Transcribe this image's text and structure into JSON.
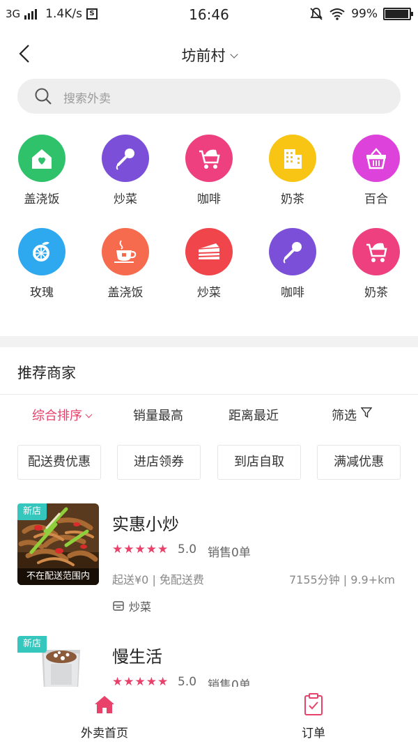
{
  "status_bar": {
    "network": "3G",
    "speed": "1.4K/s",
    "sim_badge": "S",
    "time": "16:46",
    "battery": "99%"
  },
  "header": {
    "location": "坊前村"
  },
  "search": {
    "placeholder": "搜索外卖"
  },
  "categories": [
    {
      "label": "盖浇饭",
      "icon": "house-heart-icon",
      "color": "#2fc26b"
    },
    {
      "label": "炒菜",
      "icon": "microphone-icon",
      "color": "#7b4fd8"
    },
    {
      "label": "咖啡",
      "icon": "stroller-icon",
      "color": "#ee3f7f"
    },
    {
      "label": "奶茶",
      "icon": "building-icon",
      "color": "#f8c515"
    },
    {
      "label": "百合",
      "icon": "basket-icon",
      "color": "#dd43db"
    },
    {
      "label": "玫瑰",
      "icon": "orange-icon",
      "color": "#2ea8ee"
    },
    {
      "label": "盖浇饭",
      "icon": "teacup-icon",
      "color": "#f66a4e"
    },
    {
      "label": "炒菜",
      "icon": "cake-icon",
      "color": "#f0454a"
    },
    {
      "label": "咖啡",
      "icon": "microphone-icon",
      "color": "#7b4fd8"
    },
    {
      "label": "奶茶",
      "icon": "stroller-icon",
      "color": "#ee3f7f"
    }
  ],
  "section": {
    "title": "推荐商家"
  },
  "sort_options": [
    {
      "label": "综合排序",
      "active": true
    },
    {
      "label": "销量最高",
      "active": false
    },
    {
      "label": "距离最近",
      "active": false
    },
    {
      "label": "筛选",
      "active": false
    }
  ],
  "filter_chips": [
    "配送费优惠",
    "进店领券",
    "到店自取",
    "满减优惠"
  ],
  "shops": [
    {
      "name": "实惠小炒",
      "badge": "新店",
      "range_note": "不在配送范围内",
      "rating": "5.0",
      "sold": "销售0单",
      "fee": "起送¥0 | 免配送费",
      "distance": "7155分钟 | 9.9+km",
      "tag": "炒菜"
    },
    {
      "name": "慢生活",
      "badge": "新店",
      "rating": "5.0",
      "sold": "销售0单"
    }
  ],
  "tabbar": {
    "home": "外卖首页",
    "orders": "订单"
  },
  "colors": {
    "accent": "#e8416a",
    "new_badge": "#35c6bd"
  }
}
